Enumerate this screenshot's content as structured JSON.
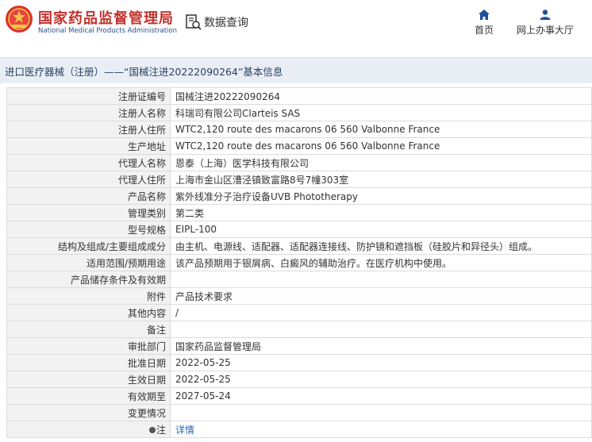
{
  "header": {
    "brand_cn": "国家药品监督管理局",
    "brand_en": "National Medical Products Administration",
    "query_label": "数据查询",
    "nav_home": "首页",
    "nav_online": "网上办事大厅"
  },
  "breadcrumb": "进口医疗器械（注册）——“国械注进20222090264”基本信息",
  "rows": [
    {
      "label": "注册证编号",
      "value": "国械注进20222090264"
    },
    {
      "label": "注册人名称",
      "value": "科瑞司有限公司Clarteis SAS"
    },
    {
      "label": "注册人住所",
      "value": "WTC2,120 route des macarons 06 560 Valbonne France"
    },
    {
      "label": "生产地址",
      "value": "WTC2,120 route des macarons 06 560 Valbonne France"
    },
    {
      "label": "代理人名称",
      "value": "恩泰（上海）医学科技有限公司"
    },
    {
      "label": "代理人住所",
      "value": "上海市金山区漕泾镇致富路8号7幢303室"
    },
    {
      "label": "产品名称",
      "value": "紫外线准分子治疗设备UVB Phototherapy"
    },
    {
      "label": "管理类别",
      "value": "第二类"
    },
    {
      "label": "型号规格",
      "value": "EIPL-100"
    },
    {
      "label": "结构及组成/主要组成成分",
      "value": "由主机、电源线、适配器、适配器连接线、防护镜和遮挡板（硅胶片和异径头）组成。"
    },
    {
      "label": "适用范围/预期用途",
      "value": "该产品预期用于银屑病、白癜风的辅助治疗。在医疗机构中使用。"
    },
    {
      "label": "产品储存条件及有效期",
      "value": ""
    },
    {
      "label": "附件",
      "value": "产品技术要求"
    },
    {
      "label": "其他内容",
      "value": "/"
    },
    {
      "label": "备注",
      "value": ""
    },
    {
      "label": "审批部门",
      "value": "国家药品监督管理局"
    },
    {
      "label": "批准日期",
      "value": "2022-05-25"
    },
    {
      "label": "生效日期",
      "value": "2022-05-25"
    },
    {
      "label": "有效期至",
      "value": "2027-05-24"
    },
    {
      "label": "变更情况",
      "value": ""
    }
  ],
  "note_row": {
    "label": "注",
    "link": "详情"
  },
  "colors": {
    "brand_red": "#c3312d",
    "brand_blue": "#2c4f8a",
    "link": "#2a66b8"
  }
}
